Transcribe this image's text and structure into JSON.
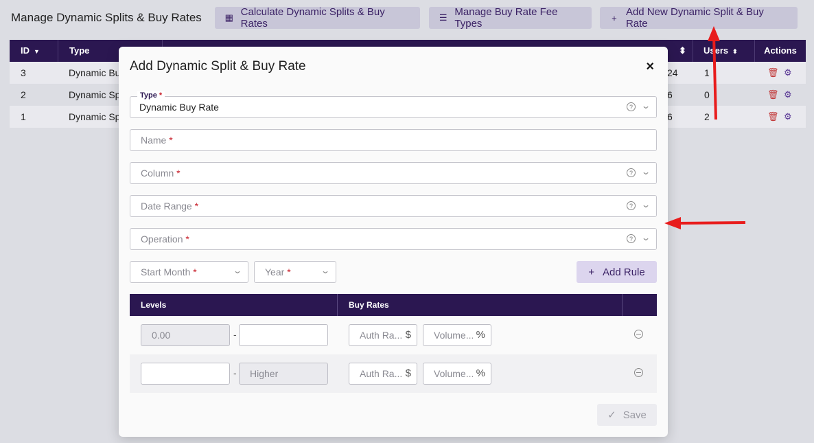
{
  "header": {
    "title": "Manage Dynamic Splits & Buy Rates",
    "buttons": {
      "calculate": "Calculate Dynamic Splits & Buy Rates",
      "fee_types": "Manage Buy Rate Fee Types",
      "add_new": "Add New Dynamic Split & Buy Rate"
    }
  },
  "table": {
    "headers": {
      "id": "ID",
      "type": "Type",
      "users": "Users",
      "actions": "Actions"
    },
    "rows": [
      {
        "id": "3",
        "type": "Dynamic Bu",
        "partial": "24",
        "users": "1"
      },
      {
        "id": "2",
        "type": "Dynamic Sp",
        "partial": "6",
        "users": "0"
      },
      {
        "id": "1",
        "type": "Dynamic Sp",
        "partial": "6",
        "users": "2"
      }
    ]
  },
  "modal": {
    "title": "Add Dynamic Split & Buy Rate",
    "close": "×",
    "type_label": "Type",
    "type_value": "Dynamic Buy Rate",
    "name_placeholder": "Name",
    "column_placeholder": "Column",
    "date_range_placeholder": "Date Range",
    "operation_placeholder": "Operation",
    "start_month_placeholder": "Start Month",
    "year_placeholder": "Year",
    "required_mark": "*",
    "add_rule": "Add Rule",
    "levels_header": "Levels",
    "buy_rates_header": "Buy Rates",
    "rows": [
      {
        "from": "0.00",
        "to": "",
        "auth_rate": "Auth Ra...",
        "volume": "Volume..."
      },
      {
        "from": "",
        "to": "Higher",
        "auth_rate": "Auth Ra...",
        "volume": "Volume..."
      }
    ],
    "dollar_suffix": "$",
    "percent_suffix": "%",
    "dash": "-",
    "save": "Save"
  },
  "colors": {
    "header_bg": "#2b1751",
    "button_bg": "#c8c6d8",
    "arrow": "#e81c1c"
  }
}
